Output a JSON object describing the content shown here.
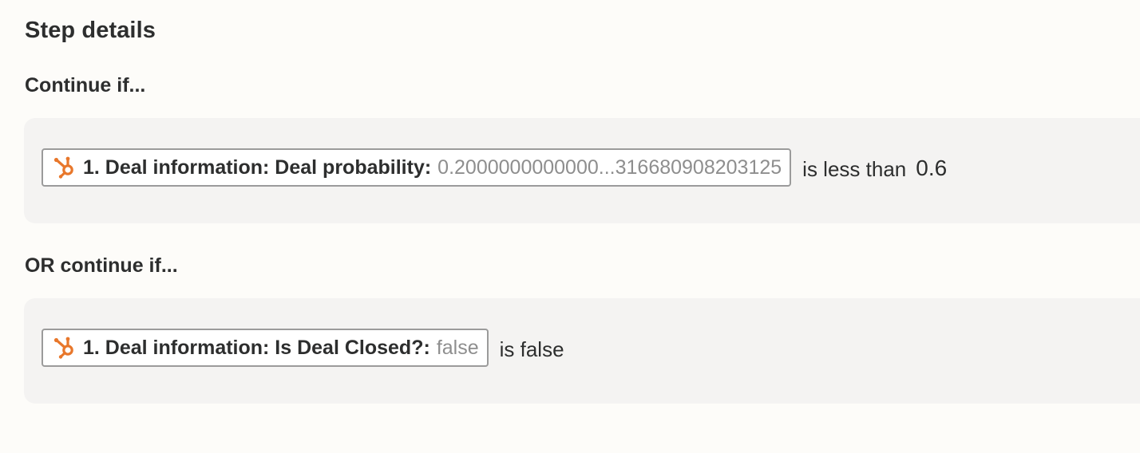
{
  "header": {
    "title": "Step details"
  },
  "groups": [
    {
      "label": "Continue if...",
      "conditions": [
        {
          "app_icon": "hubspot-icon",
          "field": "1. Deal information: Deal probability:",
          "value": "0.2000000000000...316680908203125",
          "operator": "is less than",
          "compare_value": "0.6"
        }
      ]
    },
    {
      "label": "OR continue if...",
      "conditions": [
        {
          "app_icon": "hubspot-icon",
          "field": "1. Deal information: Is Deal Closed?:",
          "value": "false",
          "operator": "is false",
          "compare_value": ""
        }
      ]
    }
  ],
  "colors": {
    "background": "#fdfcf9",
    "condition_box": "#f4f3f2",
    "hubspot_orange": "#e8772b",
    "muted_value": "#8e8e8e",
    "text": "#2d2e2e"
  }
}
